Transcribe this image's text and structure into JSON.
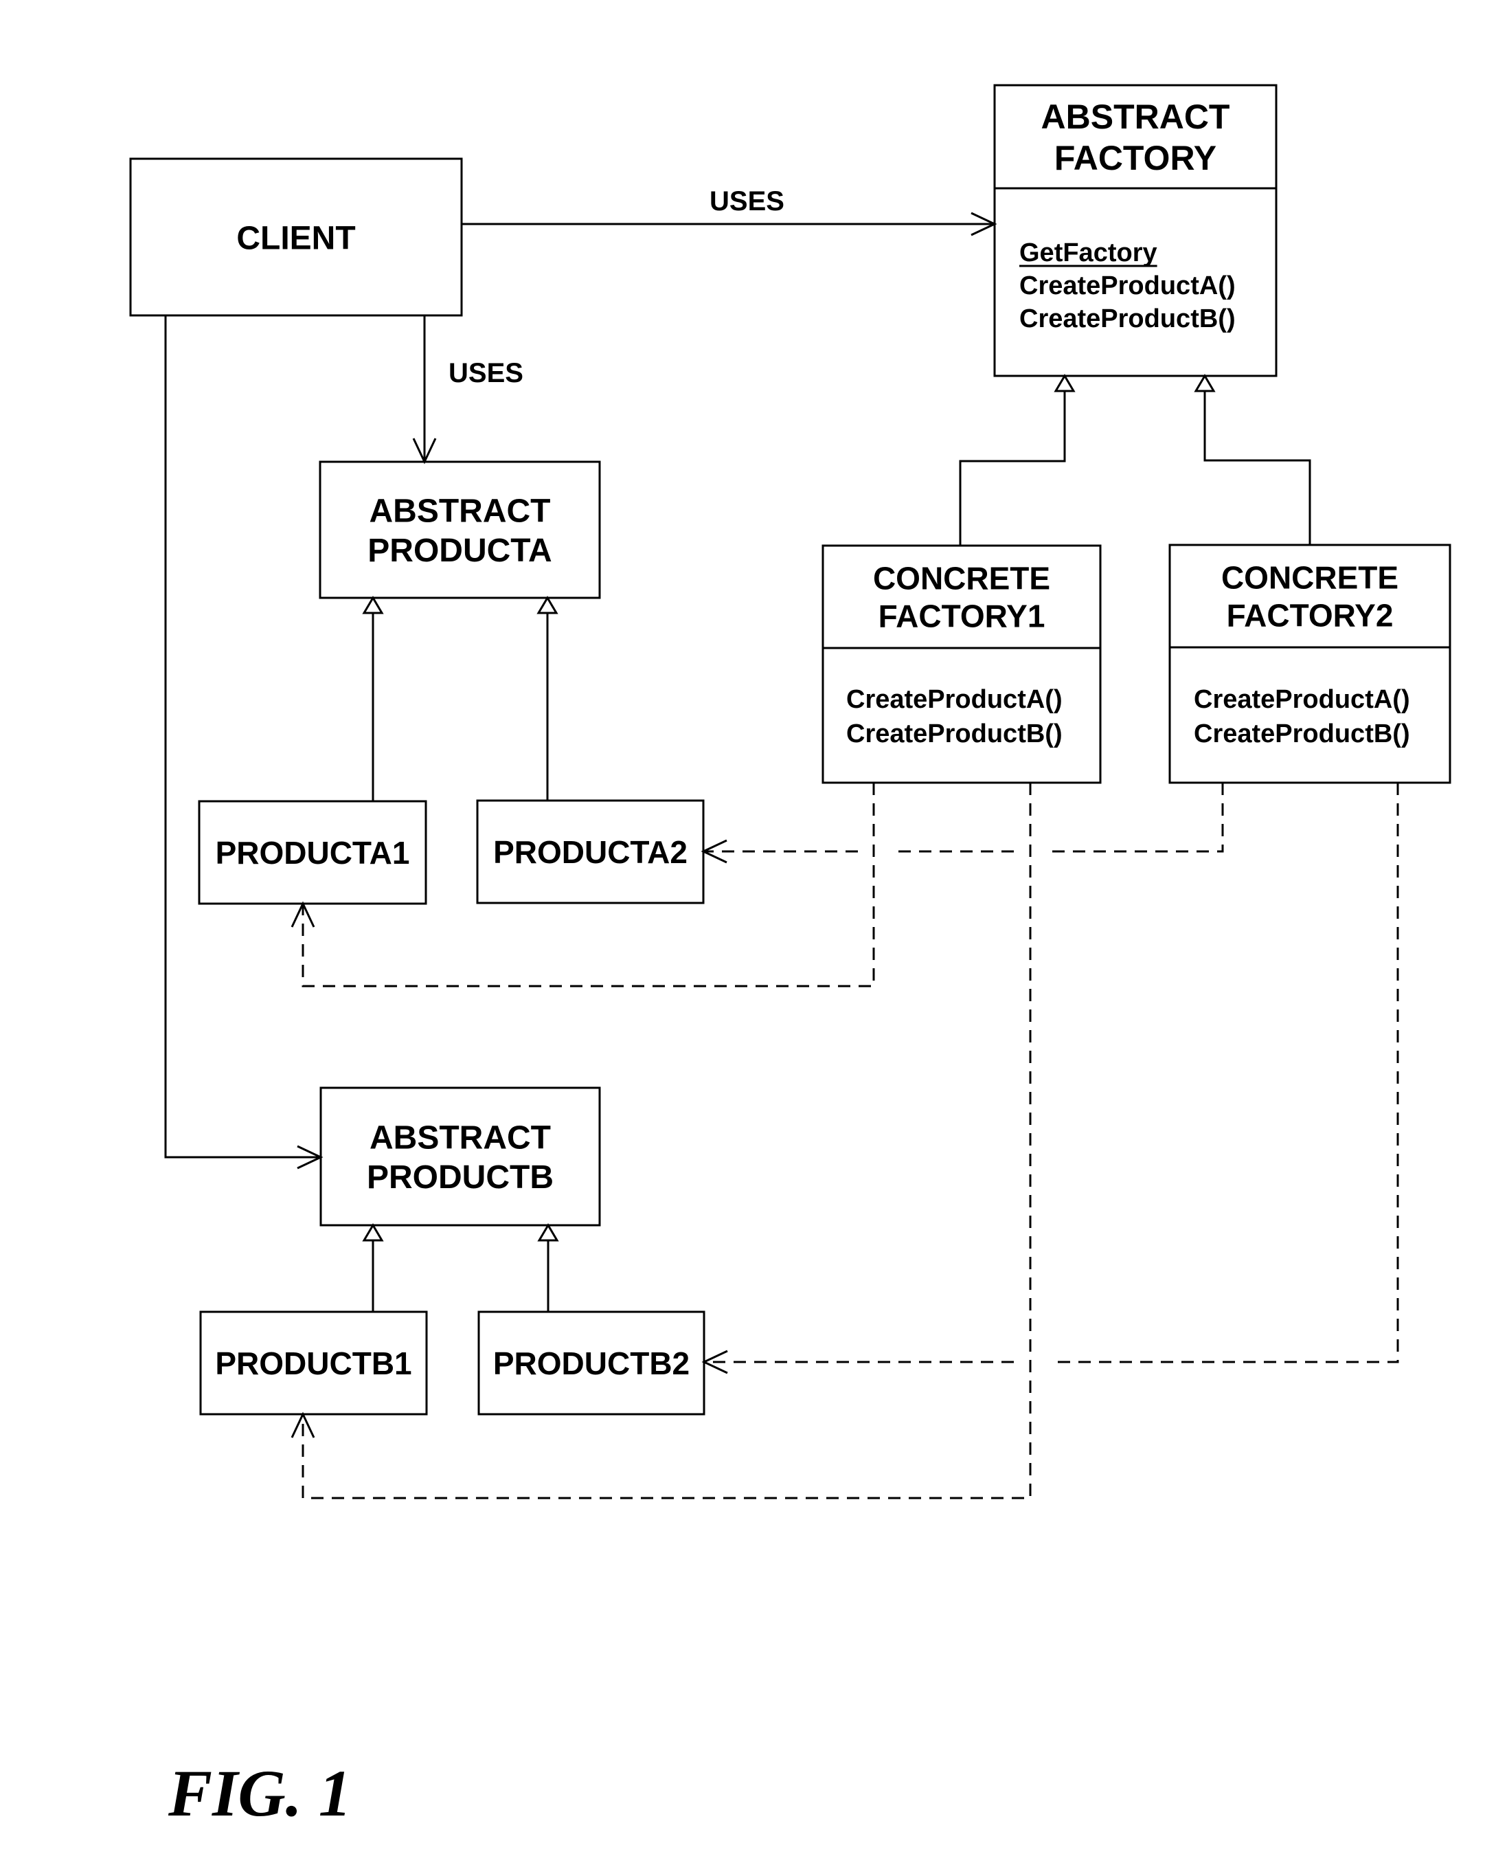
{
  "diagram": {
    "type": "UML class diagram",
    "pattern": "Abstract Factory",
    "figure_label": "FIG. 1",
    "stroke_color": "#000000",
    "background_color": "#ffffff",
    "classes": {
      "client": {
        "title": [
          "CLIENT"
        ],
        "methods": []
      },
      "abstract_factory": {
        "title": [
          "ABSTRACT",
          "FACTORY"
        ],
        "methods": [
          {
            "name": "GetFactory",
            "underlined": true
          },
          {
            "name": "CreateProductA()",
            "underlined": false
          },
          {
            "name": "CreateProductB()",
            "underlined": false
          }
        ]
      },
      "abstract_product_a": {
        "title": [
          "ABSTRACT",
          "PRODUCTA"
        ],
        "methods": []
      },
      "abstract_product_b": {
        "title": [
          "ABSTRACT",
          "PRODUCTB"
        ],
        "methods": []
      },
      "concrete_factory_1": {
        "title": [
          "CONCRETE",
          "FACTORY1"
        ],
        "methods": [
          {
            "name": "CreateProductA()",
            "underlined": false
          },
          {
            "name": "CreateProductB()",
            "underlined": false
          }
        ]
      },
      "concrete_factory_2": {
        "title": [
          "CONCRETE",
          "FACTORY2"
        ],
        "methods": [
          {
            "name": "CreateProductA()",
            "underlined": false
          },
          {
            "name": "CreateProductB()",
            "underlined": false
          }
        ]
      },
      "product_a1": {
        "title": [
          "PRODUCTA1"
        ],
        "methods": []
      },
      "product_a2": {
        "title": [
          "PRODUCTA2"
        ],
        "methods": []
      },
      "product_b1": {
        "title": [
          "PRODUCTB1"
        ],
        "methods": []
      },
      "product_b2": {
        "title": [
          "PRODUCTB2"
        ],
        "methods": []
      }
    },
    "relations": [
      {
        "from": "client",
        "to": "abstract_factory",
        "kind": "association",
        "label": "USES"
      },
      {
        "from": "client",
        "to": "abstract_product_a",
        "kind": "association",
        "label": "USES"
      },
      {
        "from": "client",
        "to": "abstract_product_b",
        "kind": "association",
        "label": ""
      },
      {
        "from": "concrete_factory_1",
        "to": "abstract_factory",
        "kind": "generalization",
        "label": ""
      },
      {
        "from": "concrete_factory_2",
        "to": "abstract_factory",
        "kind": "generalization",
        "label": ""
      },
      {
        "from": "product_a1",
        "to": "abstract_product_a",
        "kind": "generalization",
        "label": ""
      },
      {
        "from": "product_a2",
        "to": "abstract_product_a",
        "kind": "generalization",
        "label": ""
      },
      {
        "from": "product_b1",
        "to": "abstract_product_b",
        "kind": "generalization",
        "label": ""
      },
      {
        "from": "product_b2",
        "to": "abstract_product_b",
        "kind": "generalization",
        "label": ""
      },
      {
        "from": "concrete_factory_1",
        "to": "product_a1",
        "kind": "dependency",
        "label": ""
      },
      {
        "from": "concrete_factory_1",
        "to": "product_b1",
        "kind": "dependency",
        "label": ""
      },
      {
        "from": "concrete_factory_2",
        "to": "product_a2",
        "kind": "dependency",
        "label": ""
      },
      {
        "from": "concrete_factory_2",
        "to": "product_b2",
        "kind": "dependency",
        "label": ""
      }
    ],
    "labels": {
      "uses_factory": "USES",
      "uses_product_a": "USES"
    }
  }
}
